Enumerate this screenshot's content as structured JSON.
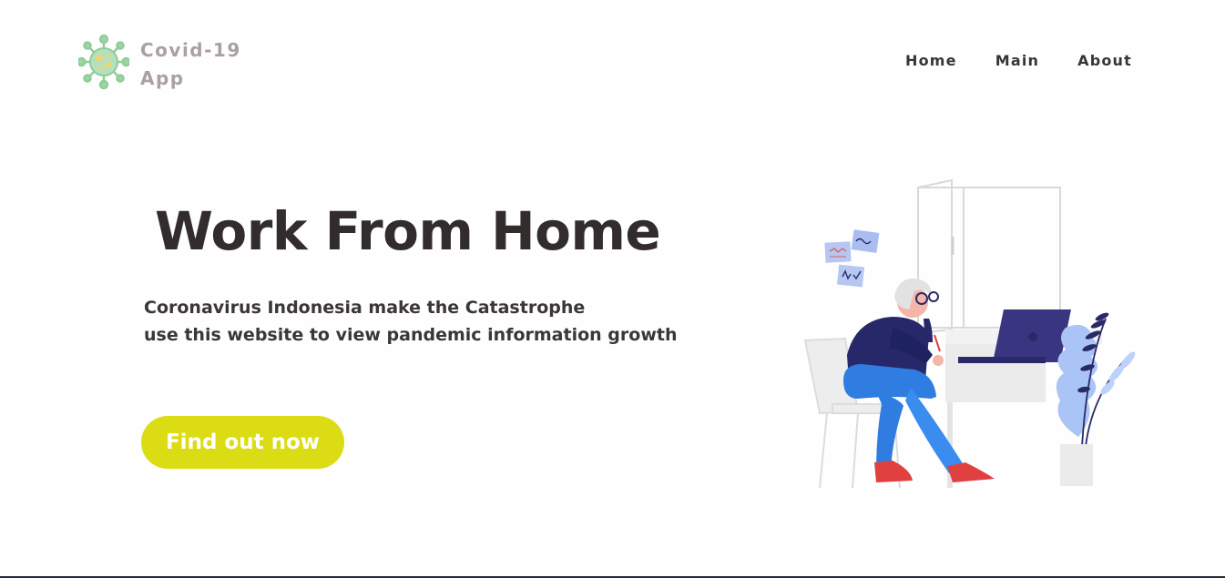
{
  "header": {
    "logo_line1": "Covid-19",
    "logo_line2": "App",
    "logo_icon": "virus-icon"
  },
  "nav": {
    "items": [
      {
        "label": "Home"
      },
      {
        "label": "Main"
      },
      {
        "label": "About"
      }
    ]
  },
  "hero": {
    "title": "Work From Home",
    "subtitle_line1": "Coronavirus Indonesia make the Catastrophe",
    "subtitle_line2": "use this website to view pandemic information growth",
    "cta_label": "Find out now",
    "illustration": "work-from-home-illustration"
  },
  "colors": {
    "logo_text": "#a9a0a6",
    "nav_text": "#3a3434",
    "title_text": "#322c2c",
    "cta_background": "#dcdc14",
    "cta_text": "#ffffff",
    "virus_green": "#9fd4a6",
    "illustration_navy": "#2a2a6a",
    "illustration_blue": "#2f7de0",
    "illustration_red": "#e04040"
  }
}
